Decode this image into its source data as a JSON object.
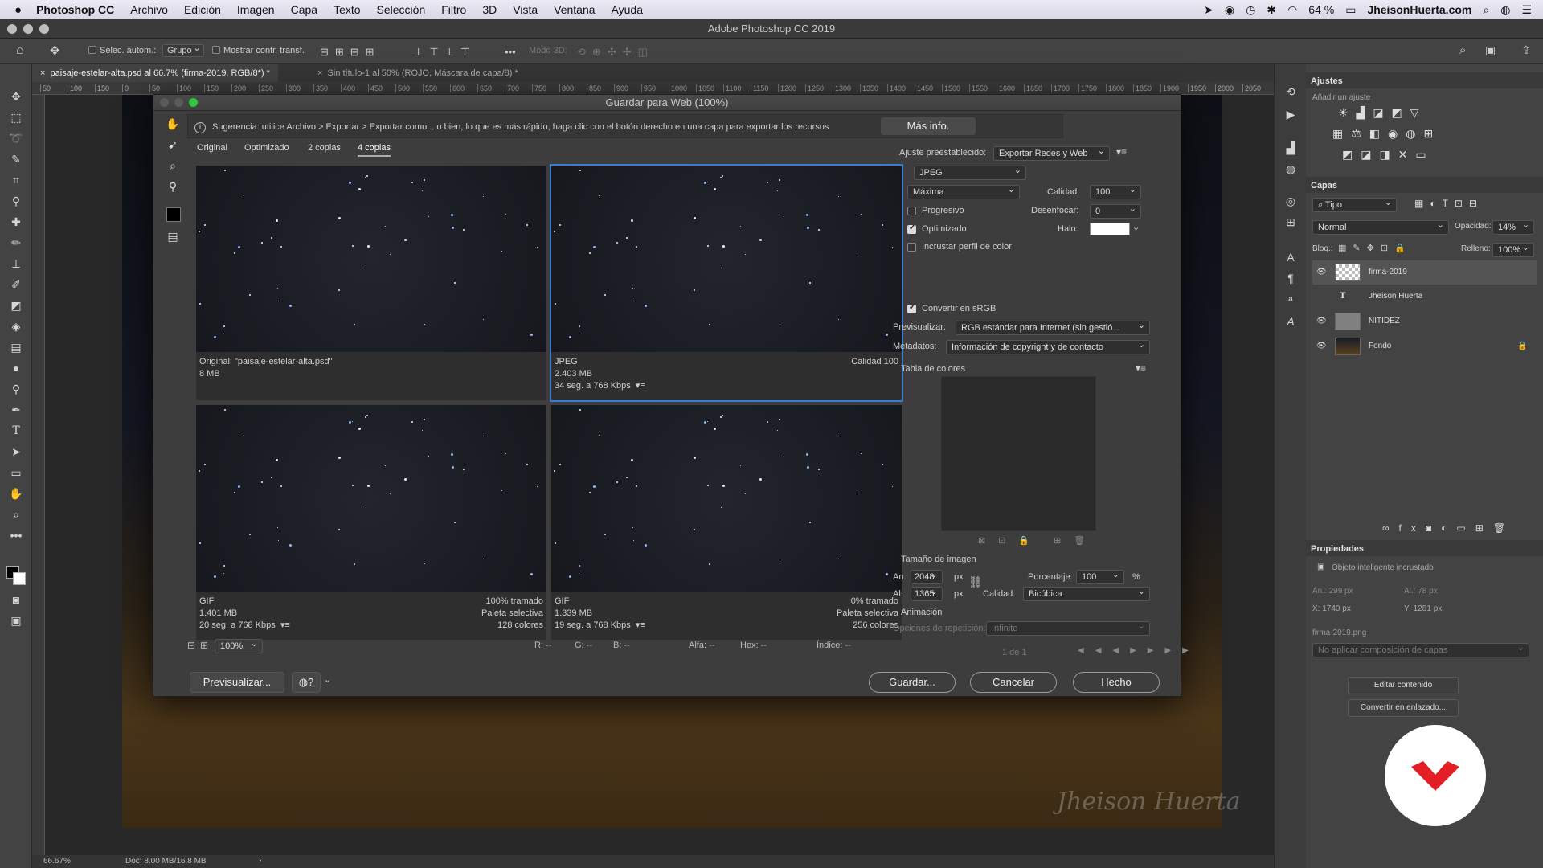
{
  "menubar": {
    "apple": "",
    "app": "Photoshop CC",
    "items": [
      "Archivo",
      "Edición",
      "Imagen",
      "Capa",
      "Texto",
      "Selección",
      "Filtro",
      "3D",
      "Vista",
      "Ventana",
      "Ayuda"
    ],
    "battery": "64 %",
    "site": "JheisonHuerta.com"
  },
  "window": {
    "title": "Adobe Photoshop CC 2019"
  },
  "options": {
    "auto_select": "Selec. autom.:",
    "group": "Grupo",
    "show_transform": "Mostrar contr. transf.",
    "mode3d": "Modo 3D:"
  },
  "tabs": [
    {
      "label": "paisaje-estelar-alta.psd al 66.7% (firma-2019, RGB/8*) *"
    },
    {
      "label": "Sin título-1 al 50% (ROJO, Máscara de capa/8) *"
    }
  ],
  "ruler": [
    "50",
    "100",
    "150",
    "0",
    "50",
    "100",
    "150",
    "200",
    "250",
    "300",
    "350",
    "400",
    "450",
    "500",
    "550",
    "600",
    "650",
    "700",
    "750",
    "800",
    "850",
    "900",
    "950",
    "1000",
    "1050",
    "1100",
    "1150",
    "1200",
    "1250",
    "1300",
    "1350",
    "1400",
    "1450",
    "1500",
    "1550",
    "1600",
    "1650",
    "1700",
    "1750",
    "1800",
    "1850",
    "1900",
    "1950",
    "2000",
    "2050"
  ],
  "status": {
    "zoom": "66.67%",
    "doc": "Doc: 8.00 MB/16.8 MB"
  },
  "dialog": {
    "title": "Guardar para Web (100%)",
    "hint": "Sugerencia: utilice Archivo > Exportar > Exportar como... o bien, lo que es más rápido, haga clic con el botón derecho en una capa para exportar los recursos",
    "more_info": "Más info.",
    "view_tabs": [
      "Original",
      "Optimizado",
      "2 copias",
      "4 copias"
    ],
    "panes": [
      {
        "l1": "Original: \"paisaje-estelar-alta.psd\"",
        "l2": "8 MB",
        "l3": "",
        "r1": "",
        "r2": "",
        "r3": ""
      },
      {
        "l1": "JPEG",
        "l2": "2.403 MB",
        "l3": "34 seg. a 768 Kbps",
        "r1": "Calidad 100",
        "r2": "",
        "r3": ""
      },
      {
        "l1": "GIF",
        "l2": "1.401 MB",
        "l3": "20 seg. a 768 Kbps",
        "r1": "100% tramado",
        "r2": "Paleta selectiva",
        "r3": "128 colores"
      },
      {
        "l1": "GIF",
        "l2": "1.339 MB",
        "l3": "19 seg. a 768 Kbps",
        "r1": "0% tramado",
        "r2": "Paleta selectiva",
        "r3": "256 colores"
      }
    ],
    "settings": {
      "preset_label": "Ajuste preestablecido:",
      "preset": "Exportar Redes y Web",
      "format": "JPEG",
      "quality_mode": "Máxima",
      "quality_label": "Calidad:",
      "quality": "100",
      "progressive": "Progresivo",
      "blur_label": "Desenfocar:",
      "blur": "0",
      "optimized": "Optimizado",
      "matte_label": "Halo:",
      "embed": "Incrustar perfil de color",
      "srgb": "Convertir en sRGB",
      "preview_label": "Previsualizar:",
      "preview": "RGB estándar para Internet (sin gestió...",
      "meta_label": "Metadatos:",
      "meta": "Información de copyright y de contacto",
      "colortable": "Tabla de colores",
      "imgsize": "Tamaño de imagen",
      "w_label": "An:",
      "w": "2048",
      "h_label": "Al:",
      "h": "1365",
      "px": "px",
      "pct_label": "Porcentaje:",
      "pct": "100",
      "pct_unit": "%",
      "resample_label": "Calidad:",
      "resample": "Bicúbica",
      "anim": "Animación",
      "loop_label": "Opciones de repetición:",
      "loop": "Infinito",
      "frame": "1 de 1"
    },
    "zoom": "100%",
    "readout": {
      "r": "R: --",
      "g": "G: --",
      "b": "B: --",
      "alpha": "Alfa: --",
      "hex": "Hex: --",
      "index": "Índice: --"
    },
    "buttons": {
      "preview": "Previsualizar...",
      "save": "Guardar...",
      "cancel": "Cancelar",
      "done": "Hecho"
    }
  },
  "panels": {
    "ajustes": "Ajustes",
    "add_adj": "Añadir un ajuste",
    "capas": "Capas",
    "kind": "Tipo",
    "blend": "Normal",
    "opacity_label": "Opacidad:",
    "opacity": "14%",
    "lock_label": "Bloq.:",
    "fill_label": "Relleno:",
    "fill": "100%",
    "layers": [
      {
        "name": "firma-2019"
      },
      {
        "name": "Jheison Huerta"
      },
      {
        "name": "NITIDEZ"
      },
      {
        "name": "Fondo"
      }
    ],
    "props": "Propiedades",
    "smart": "Objeto inteligente incrustado",
    "an": "An.: 299 px",
    "al": "Al.: 78 px",
    "x": "X: 1740 px",
    "y": "Y: 1281 px",
    "file": "firma-2019.png",
    "comp": "No aplicar composición de capas",
    "edit": "Editar contenido",
    "convert": "Convertir en enlazado..."
  },
  "signature": "Jheison Huerta",
  "colors": {
    "accent": "#3b7bd4",
    "logo": "#e31e24"
  }
}
